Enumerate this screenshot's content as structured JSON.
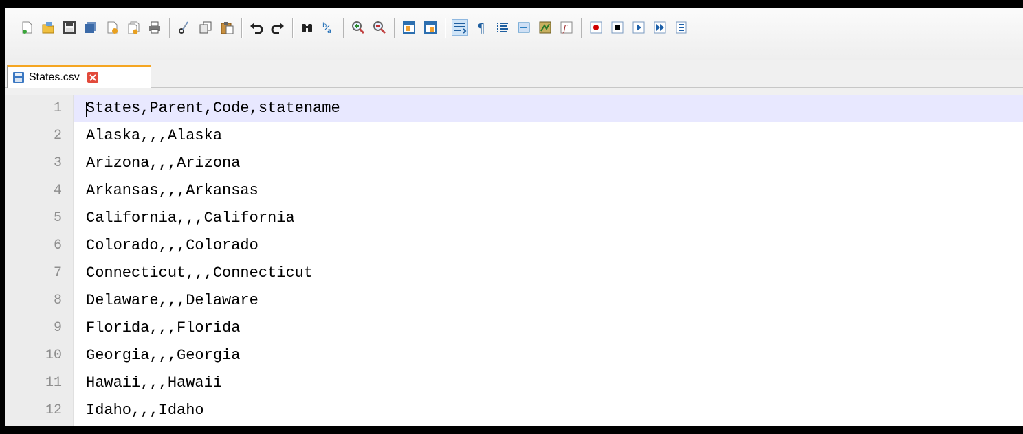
{
  "window": {
    "title": ""
  },
  "toolbar": {
    "buttons": [
      {
        "name": "new-file-icon",
        "color": "#4a90e2"
      },
      {
        "name": "open-file-icon",
        "color": "#e0a000"
      },
      {
        "name": "save-icon",
        "color": "#2c5f9e"
      },
      {
        "name": "save-all-icon",
        "color": "#2c5f9e"
      },
      {
        "name": "close-icon",
        "color": "#d9534f"
      },
      {
        "name": "close-all-icon",
        "color": "#d9534f"
      },
      {
        "name": "print-icon",
        "color": "#555"
      },
      {
        "name": "cut-icon",
        "color": "#555"
      },
      {
        "name": "copy-icon",
        "color": "#555"
      },
      {
        "name": "paste-icon",
        "color": "#b07a20"
      },
      {
        "name": "undo-icon",
        "color": "#333"
      },
      {
        "name": "redo-icon",
        "color": "#333"
      },
      {
        "name": "find-icon",
        "color": "#333"
      },
      {
        "name": "replace-icon",
        "color": "#1c6bb5"
      },
      {
        "name": "zoom-in-icon",
        "color": "#2a7a2a"
      },
      {
        "name": "zoom-out-icon",
        "color": "#c0392b"
      },
      {
        "name": "sync-vertical-icon",
        "color": "#2c6fb0"
      },
      {
        "name": "sync-horizontal-icon",
        "color": "#2c6fb0"
      },
      {
        "name": "word-wrap-icon",
        "color": "#1f5fa0"
      },
      {
        "name": "show-all-characters-icon",
        "color": "#1f5fa0"
      },
      {
        "name": "indent-guide-icon",
        "color": "#1f5fa0"
      },
      {
        "name": "user-language-icon",
        "color": "#2d7fc0"
      },
      {
        "name": "document-map-icon",
        "color": "#3d8a3d"
      },
      {
        "name": "function-list-icon",
        "color": "#a03030"
      },
      {
        "name": "start-recording-icon",
        "color": "#d00000"
      },
      {
        "name": "stop-recording-icon",
        "color": "#000000"
      },
      {
        "name": "playback-icon",
        "color": "#1c5fa8"
      },
      {
        "name": "run-multiple-macro-icon",
        "color": "#1c5fa8"
      },
      {
        "name": "save-macro-icon",
        "color": "#1c5fa8"
      }
    ]
  },
  "tab": {
    "label": "States.csv",
    "close_color": "#e24a3b"
  },
  "editor": {
    "line_numbers": [
      "1",
      "2",
      "3",
      "4",
      "5",
      "6",
      "7",
      "8",
      "9",
      "10",
      "11",
      "12"
    ],
    "lines": [
      "States,Parent,Code,statename",
      "Alaska,,,Alaska",
      "Arizona,,,Arizona",
      "Arkansas,,,Arkansas",
      "California,,,California",
      "Colorado,,,Colorado",
      "Connecticut,,,Connecticut",
      "Delaware,,,Delaware",
      "Florida,,,Florida",
      "Georgia,,,Georgia",
      "Hawaii,,,Hawaii",
      "Idaho,,,Idaho"
    ],
    "current_line_color": "#e8e8ff"
  }
}
